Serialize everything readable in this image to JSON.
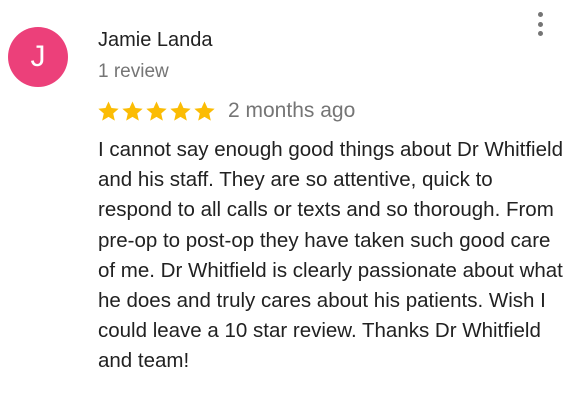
{
  "review": {
    "avatar_letter": "J",
    "avatar_color": "#ec407a",
    "reviewer_name": "Jamie Landa",
    "review_count": "1 review",
    "rating": 5,
    "rating_max": 5,
    "star_color": "#fbbc04",
    "time_ago": "2 months ago",
    "text": "I cannot say enough good things about Dr Whitfield and his staff. They are so attentive, quick to respond to all calls or texts and so thorough. From pre-op to post-op they have taken such good care of me. Dr Whitfield is clearly passionate about what he does and truly cares about his patients. Wish I could leave a 10 star review. Thanks Dr Whitfield and team!",
    "more_icon": "more-vertical-icon"
  }
}
